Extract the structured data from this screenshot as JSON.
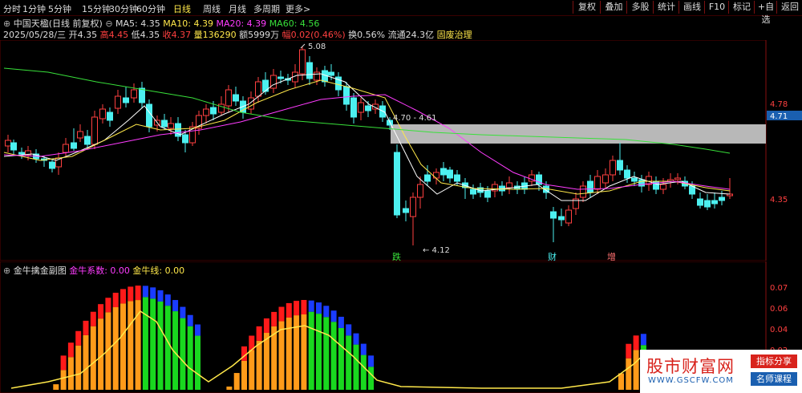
{
  "toolbar": {
    "periods": [
      "分时",
      "1分钟",
      "5分钟",
      "15分钟",
      "30分钟",
      "60分钟",
      "日线",
      "周线",
      "月线",
      "多周期",
      "更多>"
    ],
    "active_period": "日线",
    "buttons": [
      "复权",
      "叠加",
      "多股",
      "统计",
      "画线",
      "F10",
      "标记",
      "+自选",
      "返回"
    ]
  },
  "header": {
    "title": "中国天楹(日线 前复权)",
    "ma5_label": "MA5: 4.35",
    "ma10_label": "MA10: 4.39",
    "ma20_label": "MA20: 4.39",
    "ma60_label": "MA60: 4.56",
    "date": "2025/05/28/三",
    "open": "开4.35",
    "high": "高4.45",
    "low": "低4.35",
    "close": "收4.37",
    "volume": "量136290",
    "amount": "额5999万",
    "change": "幅0.02(0.46%)",
    "turnover": "换0.56%",
    "float_cap": "流通24.3亿",
    "concept": "固废治理"
  },
  "main": {
    "axis_labels": [
      "4.78",
      "4.71",
      "4.35"
    ],
    "high_marker": "5.08",
    "low_marker": "4.12",
    "range_label": "4.70 - 4.61",
    "event_tags": [
      "跌",
      "财",
      "增"
    ],
    "colors": {
      "up": "#ff4040",
      "down": "#4cf0f0",
      "ma5": "#ffffff",
      "ma10": "#ffe84a",
      "ma20": "#ff3cff",
      "ma60": "#38e03a",
      "band": "#b8b8b8"
    }
  },
  "sub": {
    "title": "金牛擒金副图",
    "coef_label": "金牛系数: 0.00",
    "line_label": "金牛线: 0.00",
    "axis_labels": [
      "0.07",
      "0.06",
      "0.04",
      "0.02"
    ]
  },
  "watermark": {
    "brand": "股市财富网",
    "url": "WWW.GSCFW.COM",
    "tag1": "指标分享",
    "tag2": "名师课程"
  }
}
